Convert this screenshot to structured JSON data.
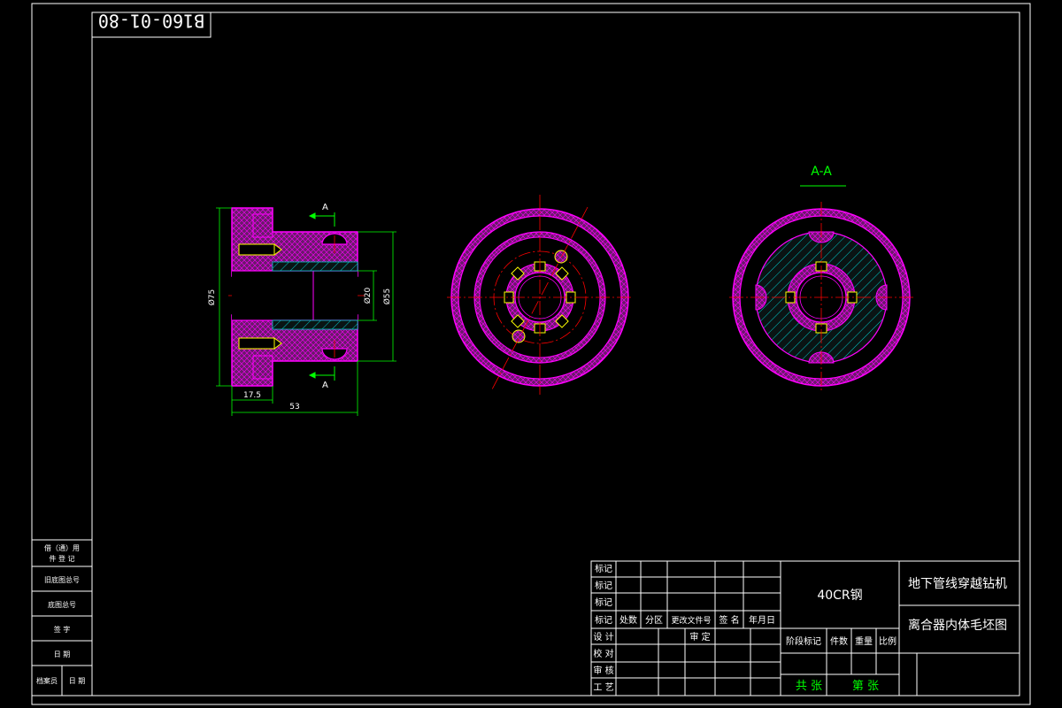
{
  "drawing_number": "B160-01-80",
  "views": {
    "section_label": "A-A",
    "cut_mark": "A"
  },
  "dimensions": {
    "d75": "Ø75",
    "d20": "Ø20",
    "d55": "Ø55",
    "len_17_5": "17.5",
    "len_53": "53"
  },
  "left_column": {
    "rows": [
      {
        "a": "借（通）用",
        "b": "件 登 记"
      },
      {
        "a": "旧底图总号",
        "b": ""
      },
      {
        "a": "底图总号",
        "b": ""
      },
      {
        "a": "签    字",
        "b": ""
      },
      {
        "a": "日    期",
        "b": ""
      },
      {
        "a": "档案员",
        "b": "日 期"
      }
    ]
  },
  "title_block": {
    "rev_rows": [
      "标记",
      "标记",
      "标记"
    ],
    "rev_header": [
      "标记",
      "处数",
      "分区",
      "更改文件号",
      "签 名",
      "年月日"
    ],
    "sign_rows": [
      "设 计",
      "校 对",
      "审 核",
      "工 艺"
    ],
    "approve": "审 定",
    "material": "40CR钢",
    "stage_header": [
      "阶段标记",
      "件数",
      "重量",
      "比例"
    ],
    "sheets": "共   张",
    "sheet_no": "第   张",
    "project": "地下管线穿越钻机",
    "part_name": "离合器内体毛坯图"
  },
  "colors": {
    "background": "#000000",
    "frame": "#ffffff",
    "outline": "#ff00ff",
    "section_fill": "#7a1f7a",
    "hatch": "#00ffff",
    "center_line": "#ff0000",
    "dimension": "#00ff00",
    "hidden": "#ffff00"
  }
}
